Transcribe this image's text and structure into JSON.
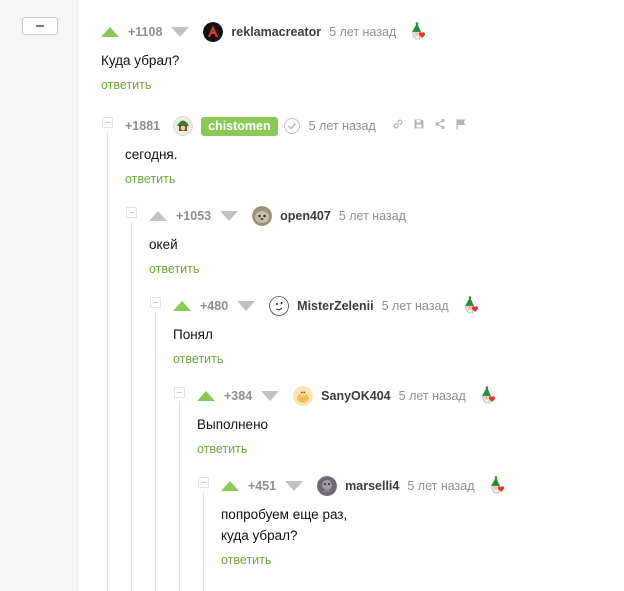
{
  "ui": {
    "collapse_label": "−",
    "reply_label": "ответить"
  },
  "colors": {
    "upvote": "#8ac858",
    "badge": "#8ac858",
    "reply_link": "#6fa640",
    "muted": "#8f8f8f"
  },
  "comments": [
    {
      "rating": "+1108",
      "username": "reklamacreator",
      "time": "5 лет назад",
      "body_lines": [
        "Куда убрал?"
      ],
      "award": "elf-heart-award-icon"
    },
    {
      "rating": "+1881",
      "username": "chistomen",
      "time": "5 лет назад",
      "body_lines": [
        "сегодня."
      ],
      "badge": true,
      "verified": true,
      "actions": [
        "link-icon",
        "save-icon",
        "share-icon",
        "report-flag-icon"
      ]
    },
    {
      "rating": "+1053",
      "username": "open407",
      "time": "5 лет назад",
      "body_lines": [
        "окей"
      ]
    },
    {
      "rating": "+480",
      "username": "MisterZelenii",
      "time": "5 лет назад",
      "body_lines": [
        "Понял"
      ],
      "award": "elf-heart-award-icon"
    },
    {
      "rating": "+384",
      "username": "SanyOK404",
      "time": "5 лет назад",
      "body_lines": [
        "Выполнено"
      ],
      "award": "elf-heart-award-icon"
    },
    {
      "rating": "+451",
      "username": "marselli4",
      "time": "5 лет назад",
      "body_lines": [
        "попробуем еще раз,",
        "куда убрал?"
      ],
      "award": "elf-heart-award-icon"
    }
  ]
}
